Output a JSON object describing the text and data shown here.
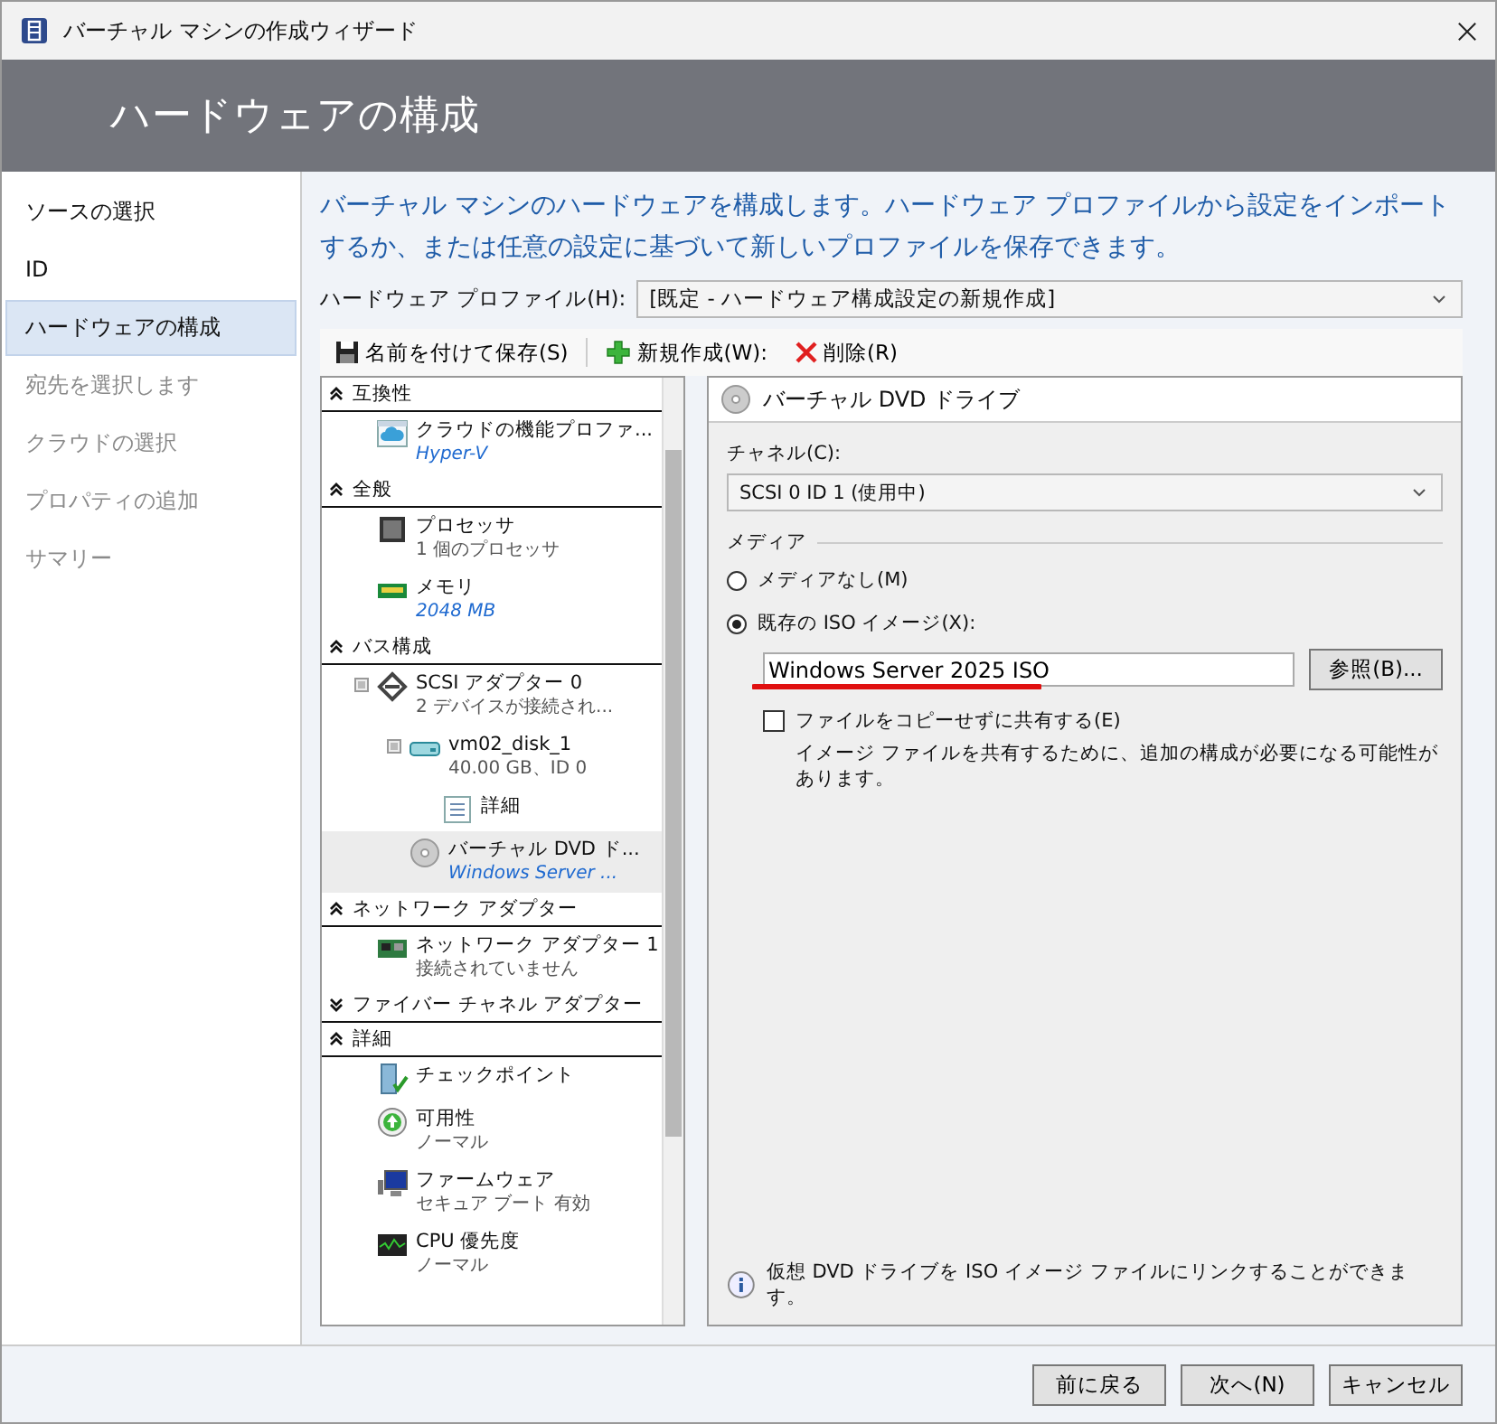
{
  "window": {
    "title": "バーチャル マシンの作成ウィザード"
  },
  "header": {
    "title": "ハードウェアの構成"
  },
  "steps": [
    {
      "label": "ソースの選択",
      "selected": false,
      "disabled": false
    },
    {
      "label": "ID",
      "selected": false,
      "disabled": false
    },
    {
      "label": "ハードウェアの構成",
      "selected": true,
      "disabled": false
    },
    {
      "label": "宛先を選択します",
      "selected": false,
      "disabled": true
    },
    {
      "label": "クラウドの選択",
      "selected": false,
      "disabled": true
    },
    {
      "label": "プロパティの追加",
      "selected": false,
      "disabled": true
    },
    {
      "label": "サマリー",
      "selected": false,
      "disabled": true
    }
  ],
  "intro": "バーチャル マシンのハードウェアを構成します。ハードウェア プロファイルから設定をインポートするか、または任意の設定に基づいて新しいプロファイルを保存できます。",
  "profile": {
    "label": "ハードウェア プロファイル(H):",
    "value": "[既定 - ハードウェア構成設定の新規作成]"
  },
  "toolbar": [
    {
      "kind": "save",
      "label": "名前を付けて保存(S)"
    },
    {
      "kind": "new",
      "label": "新規作成(W):"
    },
    {
      "kind": "delete",
      "label": "削除(R)"
    }
  ],
  "tree": [
    {
      "title": "互換性",
      "expanded": true,
      "items": [
        {
          "kind": "cloud",
          "name": "クラウドの機能プロファ...",
          "detail": "Hyper-V",
          "detail_link": true,
          "selected": false
        }
      ]
    },
    {
      "title": "全般",
      "expanded": true,
      "items": [
        {
          "kind": "cpu",
          "name": "プロセッサ",
          "detail": "1 個のプロセッサ",
          "detail_link": false,
          "selected": false
        },
        {
          "kind": "memory",
          "name": "メモリ",
          "detail": "2048 MB",
          "detail_link": true,
          "selected": false
        }
      ]
    },
    {
      "title": "バス構成",
      "expanded": true,
      "items": [
        {
          "kind": "scsi",
          "name": "SCSI アダプター 0",
          "detail": "2 デバイスが接続され...",
          "detail_link": false,
          "selected": false,
          "expanded": true,
          "children": [
            {
              "kind": "disk",
              "name": "vm02_disk_1",
              "detail": "40.00 GB、ID 0",
              "detail_link": false,
              "selected": false,
              "expanded": true,
              "children": [
                {
                  "kind": "details",
                  "name": "詳細",
                  "selected": false
                }
              ]
            },
            {
              "kind": "dvd",
              "name": "バーチャル DVD ド...",
              "detail": "Windows Server ...",
              "detail_link": true,
              "selected": true
            }
          ]
        }
      ]
    },
    {
      "title": "ネットワーク アダプター",
      "expanded": true,
      "items": [
        {
          "kind": "nic",
          "name": "ネットワーク アダプター 1",
          "detail": "接続されていません",
          "detail_link": false,
          "selected": false
        }
      ]
    },
    {
      "title": "ファイバー チャネル アダプター",
      "expanded": false
    },
    {
      "title": "詳細",
      "expanded": true,
      "items": [
        {
          "kind": "checkpoint",
          "name": "チェックポイント",
          "selected": false
        },
        {
          "kind": "availability",
          "name": "可用性",
          "detail": "ノーマル",
          "detail_link": false,
          "selected": false
        },
        {
          "kind": "firmware",
          "name": "ファームウェア",
          "detail": "セキュア ブート 有効",
          "detail_link": false,
          "selected": false
        },
        {
          "kind": "cpu-priority",
          "name": "CPU 優先度",
          "detail": "ノーマル",
          "detail_link": false,
          "selected": false
        }
      ]
    }
  ],
  "panel": {
    "title": "バーチャル DVD ドライブ",
    "channel_label": "チャネル(C):",
    "channel_value": "SCSI 0 ID 1 (使用中)",
    "media_label": "メディア",
    "media_options": [
      {
        "label": "メディアなし(M)",
        "selected": false
      },
      {
        "label": "既存の ISO イメージ(X):",
        "selected": true
      }
    ],
    "iso_path": "Windows Server 2025 ISO",
    "browse": "参照(B)...",
    "share": {
      "label": "ファイルをコピーせずに共有する(E)",
      "checked": false
    },
    "share_note": "イメージ ファイルを共有するために、追加の構成が必要になる可能性があります。",
    "info": "仮想 DVD ドライブを ISO イメージ ファイルにリンクすることができます。"
  },
  "buttons": [
    "前に戻る",
    "次へ(N)",
    "キャンセル"
  ]
}
